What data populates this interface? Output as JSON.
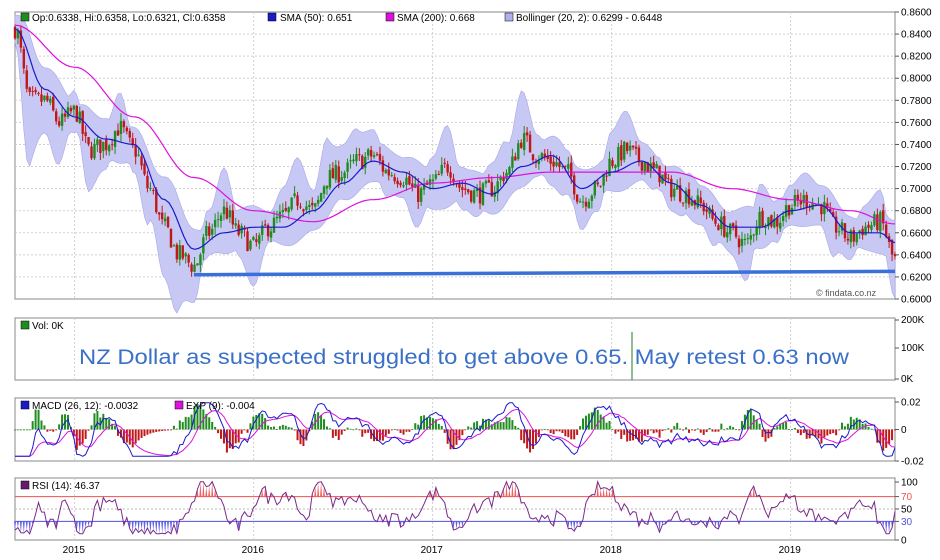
{
  "price_panel": {
    "legend": {
      "ohlc": "Op:0.6338, Hi:0.6358, Lo:0.6321, Cl:0.6358",
      "sma50": "SMA (50): 0.651",
      "sma200": "SMA (200): 0.668",
      "bollinger": "Bollinger (20, 2): 0.6299 - 0.6448"
    },
    "watermark": "© findata.co.nz",
    "y_ticks": [
      "0.8600",
      "0.8400",
      "0.8200",
      "0.8000",
      "0.7800",
      "0.7600",
      "0.7400",
      "0.7200",
      "0.7000",
      "0.6800",
      "0.6600",
      "0.6400",
      "0.6200",
      "0.6000"
    ]
  },
  "volume_panel": {
    "legend": "Vol: 0K",
    "y_ticks": [
      "200K",
      "100K",
      "0K"
    ],
    "annotation": "NZ Dollar as suspected struggled to get above 0.65. May retest 0.63 now"
  },
  "macd_panel": {
    "legend_macd": "MACD (26, 12): -0.0032",
    "legend_exp": "EXP (9): -0.004",
    "y_ticks": [
      "0.02",
      "0",
      "-0.02"
    ]
  },
  "rsi_panel": {
    "legend": "RSI (14): 46.37",
    "y_ticks": [
      "100",
      "70",
      "50",
      "30",
      "0"
    ]
  },
  "x_ticks": [
    "2015",
    "2016",
    "2017",
    "2018",
    "2019"
  ],
  "colors": {
    "up_candle": "#1e8c1e",
    "down_candle": "#c01818",
    "sma50": "#1a1acc",
    "sma200": "#dd11dd",
    "bollinger_fill": "#c8c8f4",
    "support_line": "#3a70d8",
    "macd_line": "#1a1acc",
    "exp_line": "#dd11dd",
    "rsi_line": "#7a2a8a",
    "overbought": "#f05050",
    "oversold": "#5050e0"
  },
  "chart_data": {
    "type": "line",
    "title": "",
    "x_range": [
      "2014-09",
      "2019-08"
    ],
    "price": {
      "ylim": [
        0.6,
        0.86
      ],
      "close_approx": [
        [
          "2014-09",
          0.845
        ],
        [
          "2014-10",
          0.78
        ],
        [
          "2014-11",
          0.78
        ],
        [
          "2014-12",
          0.76
        ],
        [
          "2015-01",
          0.77
        ],
        [
          "2015-02",
          0.735
        ],
        [
          "2015-03",
          0.74
        ],
        [
          "2015-04",
          0.755
        ],
        [
          "2015-05",
          0.735
        ],
        [
          "2015-06",
          0.7
        ],
        [
          "2015-07",
          0.665
        ],
        [
          "2015-08",
          0.64
        ],
        [
          "2015-09",
          0.63
        ],
        [
          "2015-10",
          0.66
        ],
        [
          "2015-11",
          0.68
        ],
        [
          "2015-12",
          0.66
        ],
        [
          "2016-01",
          0.648
        ],
        [
          "2016-02",
          0.665
        ],
        [
          "2016-03",
          0.675
        ],
        [
          "2016-04",
          0.69
        ],
        [
          "2016-05",
          0.68
        ],
        [
          "2016-06",
          0.71
        ],
        [
          "2016-07",
          0.715
        ],
        [
          "2016-08",
          0.725
        ],
        [
          "2016-09",
          0.73
        ],
        [
          "2016-10",
          0.715
        ],
        [
          "2016-11",
          0.71
        ],
        [
          "2016-12",
          0.695
        ],
        [
          "2017-01",
          0.705
        ],
        [
          "2017-02",
          0.72
        ],
        [
          "2017-03",
          0.7
        ],
        [
          "2017-04",
          0.695
        ],
        [
          "2017-05",
          0.7
        ],
        [
          "2017-06",
          0.715
        ],
        [
          "2017-07",
          0.745
        ],
        [
          "2017-08",
          0.73
        ],
        [
          "2017-09",
          0.725
        ],
        [
          "2017-10",
          0.715
        ],
        [
          "2017-11",
          0.69
        ],
        [
          "2017-12",
          0.7
        ],
        [
          "2018-01",
          0.725
        ],
        [
          "2018-02",
          0.735
        ],
        [
          "2018-03",
          0.725
        ],
        [
          "2018-04",
          0.715
        ],
        [
          "2018-05",
          0.7
        ],
        [
          "2018-06",
          0.695
        ],
        [
          "2018-07",
          0.685
        ],
        [
          "2018-08",
          0.67
        ],
        [
          "2018-09",
          0.66
        ],
        [
          "2018-10",
          0.65
        ],
        [
          "2018-11",
          0.675
        ],
        [
          "2018-12",
          0.67
        ],
        [
          "2019-01",
          0.685
        ],
        [
          "2019-02",
          0.69
        ],
        [
          "2019-03",
          0.685
        ],
        [
          "2019-04",
          0.665
        ],
        [
          "2019-05",
          0.655
        ],
        [
          "2019-06",
          0.665
        ],
        [
          "2019-07",
          0.67
        ],
        [
          "2019-08",
          0.6358
        ]
      ],
      "sma50_approx": [
        [
          "2014-09",
          0.845
        ],
        [
          "2014-11",
          0.79
        ],
        [
          "2015-01",
          0.765
        ],
        [
          "2015-03",
          0.745
        ],
        [
          "2015-05",
          0.74
        ],
        [
          "2015-07",
          0.69
        ],
        [
          "2015-09",
          0.645
        ],
        [
          "2015-11",
          0.66
        ],
        [
          "2016-01",
          0.665
        ],
        [
          "2016-03",
          0.665
        ],
        [
          "2016-05",
          0.68
        ],
        [
          "2016-07",
          0.705
        ],
        [
          "2016-09",
          0.725
        ],
        [
          "2016-11",
          0.715
        ],
        [
          "2017-01",
          0.7
        ],
        [
          "2017-03",
          0.705
        ],
        [
          "2017-05",
          0.695
        ],
        [
          "2017-07",
          0.72
        ],
        [
          "2017-09",
          0.73
        ],
        [
          "2017-11",
          0.7
        ],
        [
          "2018-01",
          0.715
        ],
        [
          "2018-03",
          0.725
        ],
        [
          "2018-05",
          0.705
        ],
        [
          "2018-07",
          0.685
        ],
        [
          "2018-09",
          0.665
        ],
        [
          "2018-11",
          0.665
        ],
        [
          "2019-01",
          0.68
        ],
        [
          "2019-03",
          0.685
        ],
        [
          "2019-05",
          0.66
        ],
        [
          "2019-07",
          0.66
        ],
        [
          "2019-08",
          0.651
        ]
      ],
      "sma200_approx": [
        [
          "2014-09",
          0.848
        ],
        [
          "2015-01",
          0.81
        ],
        [
          "2015-05",
          0.765
        ],
        [
          "2015-09",
          0.71
        ],
        [
          "2016-01",
          0.68
        ],
        [
          "2016-05",
          0.67
        ],
        [
          "2016-09",
          0.69
        ],
        [
          "2017-01",
          0.705
        ],
        [
          "2017-05",
          0.71
        ],
        [
          "2017-09",
          0.715
        ],
        [
          "2018-01",
          0.715
        ],
        [
          "2018-05",
          0.715
        ],
        [
          "2018-09",
          0.7
        ],
        [
          "2019-01",
          0.69
        ],
        [
          "2019-05",
          0.68
        ],
        [
          "2019-08",
          0.668
        ]
      ],
      "support_line": [
        [
          "2015-09",
          0.622
        ],
        [
          "2019-08",
          0.625
        ]
      ]
    },
    "volume": {
      "ylim": [
        0,
        200000
      ],
      "values": [
        0
      ]
    },
    "macd": {
      "ylim": [
        -0.02,
        0.02
      ],
      "last_macd": -0.0032,
      "last_exp": -0.004
    },
    "rsi": {
      "ylim": [
        0,
        100
      ],
      "levels": [
        30,
        50,
        70
      ],
      "last": 46.37
    }
  }
}
